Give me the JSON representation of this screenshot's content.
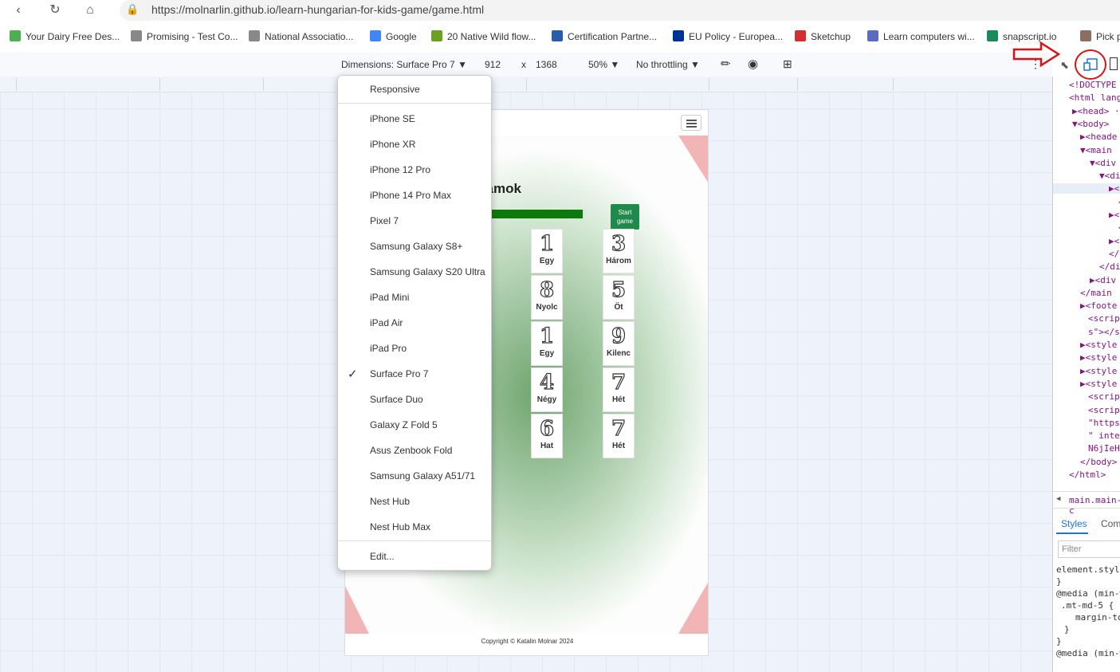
{
  "browser": {
    "url": "https://molnarlin.github.io/learn-hungarian-for-kids-game/game.html",
    "bookmarks": [
      {
        "label": "Your Dairy Free Des...",
        "icon": "leaf-icon",
        "color": "#4caf50"
      },
      {
        "label": "Promising - Test Co...",
        "icon": "page-icon",
        "color": "#888888"
      },
      {
        "label": "National Associatio...",
        "icon": "page-icon",
        "color": "#888888"
      },
      {
        "label": "Google",
        "icon": "google-icon",
        "color": "#4285f4"
      },
      {
        "label": "20 Native Wild flow...",
        "icon": "gw-icon",
        "color": "#6aa121"
      },
      {
        "label": "Certification Partne...",
        "icon": "inf-icon",
        "color": "#2a5caa"
      },
      {
        "label": "EU Policy - Europea...",
        "icon": "eu-icon",
        "color": "#003399"
      },
      {
        "label": "Sketchup",
        "icon": "sketchup-icon",
        "color": "#d32f2f"
      },
      {
        "label": "Learn computers wi...",
        "icon": "grid-icon",
        "color": "#5c6bc0"
      },
      {
        "label": "snapscript.io",
        "icon": "s-icon",
        "color": "#1b8a5a"
      },
      {
        "label": "Pick p",
        "icon": "box-icon",
        "color": "#8d6e63"
      }
    ]
  },
  "devbar": {
    "dimensions_label": "Dimensions: Surface Pro 7",
    "width": "912",
    "times": "x",
    "height": "1368",
    "zoom": "50%",
    "throttling": "No throttling"
  },
  "dropdown": {
    "items": [
      {
        "label": "Responsive",
        "checked": false
      },
      {
        "label": "iPhone SE",
        "checked": false
      },
      {
        "label": "iPhone XR",
        "checked": false
      },
      {
        "label": "iPhone 12 Pro",
        "checked": false
      },
      {
        "label": "iPhone 14 Pro Max",
        "checked": false
      },
      {
        "label": "Pixel 7",
        "checked": false
      },
      {
        "label": "Samsung Galaxy S8+",
        "checked": false
      },
      {
        "label": "Samsung Galaxy S20 Ultra",
        "checked": false
      },
      {
        "label": "iPad Mini",
        "checked": false
      },
      {
        "label": "iPad Air",
        "checked": false
      },
      {
        "label": "iPad Pro",
        "checked": false
      },
      {
        "label": "Surface Pro 7",
        "checked": true
      },
      {
        "label": "Surface Duo",
        "checked": false
      },
      {
        "label": "Galaxy Z Fold 5",
        "checked": false
      },
      {
        "label": "Asus Zenbook Fold",
        "checked": false
      },
      {
        "label": "Samsung Galaxy A51/71",
        "checked": false
      },
      {
        "label": "Nest Hub",
        "checked": false
      },
      {
        "label": "Nest Hub Max",
        "checked": false
      },
      {
        "label": "Edit...",
        "checked": false
      }
    ]
  },
  "game": {
    "heading": "zámok",
    "start_label_1": "Start",
    "start_label_2": "game",
    "progress_fraction": 0.98,
    "footer": "Copyright © Katalin Molnar 2024",
    "left_cards": [
      {
        "num": "1",
        "word": "Egy"
      },
      {
        "num": "8",
        "word": "Nyolc"
      },
      {
        "num": "1",
        "word": "Egy"
      },
      {
        "num": "4",
        "word": "Négy"
      },
      {
        "num": "6",
        "word": "Hat"
      }
    ],
    "right_cards": [
      {
        "num": "3",
        "word": "Három"
      },
      {
        "num": "5",
        "word": "Öt"
      },
      {
        "num": "9",
        "word": "Kilenc"
      },
      {
        "num": "7",
        "word": "Hét"
      },
      {
        "num": "7",
        "word": "Hét"
      }
    ]
  },
  "devtools": {
    "lines": [
      "<!DOCTYPE",
      "<html lang",
      "▶<head> ···",
      "▼<body>",
      "▶<heade",
      "▼<main",
      "▼<div",
      "▼<di",
      "▶<",
      "<",
      "▶<",
      "<",
      "▶<",
      "</d",
      "</div",
      "▶<div",
      "</main",
      "▶<foote",
      "<script",
      "s\"></s",
      "▶<style",
      "▶<style",
      "▶<style",
      "▶<style",
      "<script",
      "<script",
      "\"https",
      "\" integ",
      "N6jIeH",
      "</body>",
      "</html>"
    ],
    "breadcrumb": "main.main-c",
    "tab_styles": "Styles",
    "tab_computed": "Com",
    "filter_placeholder": "Filter",
    "rules": [
      "element.style",
      "}",
      "@media (min-w",
      ".mt-md-5 {",
      "margin-to",
      "}",
      "}",
      "@media (min-w"
    ]
  },
  "colors": {
    "accent_green": "#0b7a0b",
    "start_button": "#1f8a4c",
    "annotation_red": "#e01010",
    "corner_pink": "#f2b5b5"
  }
}
